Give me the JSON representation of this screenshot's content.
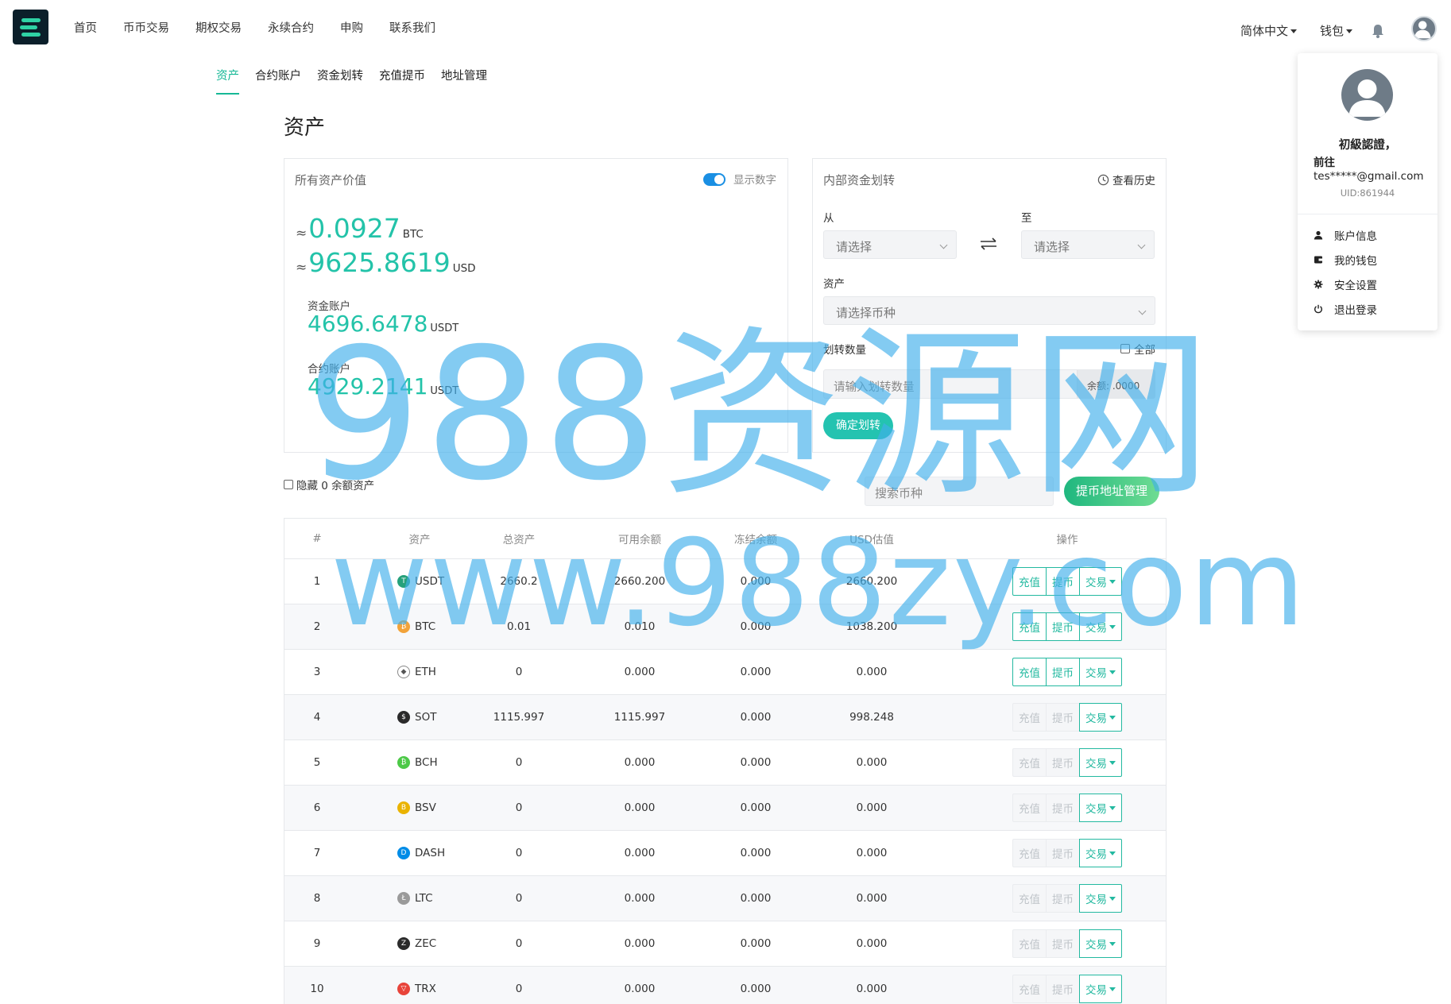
{
  "nav": {
    "items": [
      "首页",
      "币币交易",
      "期权交易",
      "永续合约",
      "申购",
      "联系我们"
    ],
    "language": "简体中文",
    "wallet": "钱包"
  },
  "subtabs": [
    "资产",
    "合约账户",
    "资金划转",
    "充值提币",
    "地址管理"
  ],
  "page_title": "资产",
  "assets_card": {
    "title": "所有资产价值",
    "toggle_label": "显示数字",
    "btc_value": "0.0927",
    "btc_unit": "BTC",
    "usd_value": "9625.8619",
    "usd_unit": "USD",
    "approx": "≈",
    "fund_account_label": "资金账户",
    "fund_account_value": "4696.6478",
    "fund_account_unit": "USDT",
    "contract_account_label": "合约账户",
    "contract_account_value": "4929.2141",
    "contract_account_unit": "USDT"
  },
  "transfer_card": {
    "title": "内部资金划转",
    "history": "查看历史",
    "from_label": "从",
    "to_label": "至",
    "from_placeholder": "请选择",
    "to_placeholder": "请选择",
    "asset_label": "资产",
    "asset_placeholder": "请选择币种",
    "amount_label": "划转数量",
    "all_label": "全部",
    "amount_placeholder": "请输入划转数量",
    "balance": "余额: .0000",
    "confirm": "确定划转"
  },
  "filters": {
    "hide_zero": "隐藏 0 余额资产",
    "search_placeholder": "搜索币种",
    "address_button": "提币地址管理"
  },
  "table": {
    "headers": [
      "#",
      "资产",
      "总资产",
      "可用余额",
      "冻结余额",
      "USD估值",
      "操作"
    ],
    "op_labels": {
      "deposit": "充值",
      "withdraw": "提币",
      "trade": "交易"
    },
    "rows": [
      {
        "idx": "1",
        "coin": "USDT",
        "total": "2660.2",
        "avail": "2660.200",
        "frozen": "0.000",
        "usd": "2660.200",
        "enabled": true,
        "icon_color": "#26a17b",
        "icon_glyph": "T"
      },
      {
        "idx": "2",
        "coin": "BTC",
        "total": "0.01",
        "avail": "0.010",
        "frozen": "0.000",
        "usd": "1038.200",
        "enabled": true,
        "icon_color": "#f2a33a",
        "icon_glyph": "₿"
      },
      {
        "idx": "3",
        "coin": "ETH",
        "total": "0",
        "avail": "0.000",
        "frozen": "0.000",
        "usd": "0.000",
        "enabled": true,
        "icon_color": "#ffffff",
        "icon_glyph": "◆"
      },
      {
        "idx": "4",
        "coin": "SOT",
        "total": "1115.997",
        "avail": "1115.997",
        "frozen": "0.000",
        "usd": "998.248",
        "enabled": false,
        "icon_color": "#2a2a2a",
        "icon_glyph": "$"
      },
      {
        "idx": "5",
        "coin": "BCH",
        "total": "0",
        "avail": "0.000",
        "frozen": "0.000",
        "usd": "0.000",
        "enabled": false,
        "icon_color": "#4cc947",
        "icon_glyph": "₿"
      },
      {
        "idx": "6",
        "coin": "BSV",
        "total": "0",
        "avail": "0.000",
        "frozen": "0.000",
        "usd": "0.000",
        "enabled": false,
        "icon_color": "#eab300",
        "icon_glyph": "B"
      },
      {
        "idx": "7",
        "coin": "DASH",
        "total": "0",
        "avail": "0.000",
        "frozen": "0.000",
        "usd": "0.000",
        "enabled": false,
        "icon_color": "#008ce7",
        "icon_glyph": "D"
      },
      {
        "idx": "8",
        "coin": "LTC",
        "total": "0",
        "avail": "0.000",
        "frozen": "0.000",
        "usd": "0.000",
        "enabled": false,
        "icon_color": "#9a9a9a",
        "icon_glyph": "Ł"
      },
      {
        "idx": "9",
        "coin": "ZEC",
        "total": "0",
        "avail": "0.000",
        "frozen": "0.000",
        "usd": "0.000",
        "enabled": false,
        "icon_color": "#2b2b2b",
        "icon_glyph": "Z"
      },
      {
        "idx": "10",
        "coin": "TRX",
        "total": "0",
        "avail": "0.000",
        "frozen": "0.000",
        "usd": "0.000",
        "enabled": false,
        "icon_color": "#e8443a",
        "icon_glyph": "▽"
      }
    ]
  },
  "user_menu": {
    "level": "初級認證，",
    "goto": "前往",
    "email": "tes*****@gmail.com",
    "uid": "UID:861944",
    "items": [
      {
        "label": "账户信息",
        "icon": "user-icon"
      },
      {
        "label": "我的钱包",
        "icon": "wallet-icon"
      },
      {
        "label": "安全设置",
        "icon": "gear-icon"
      },
      {
        "label": "退出登录",
        "icon": "power-icon"
      }
    ]
  },
  "watermark": {
    "line1": "988资源网",
    "line2": "www.988zy.com"
  },
  "colors": {
    "accent": "#23c3a9",
    "link_blue": "#1a8fe3",
    "dark_logo": "#0b1f2a"
  }
}
